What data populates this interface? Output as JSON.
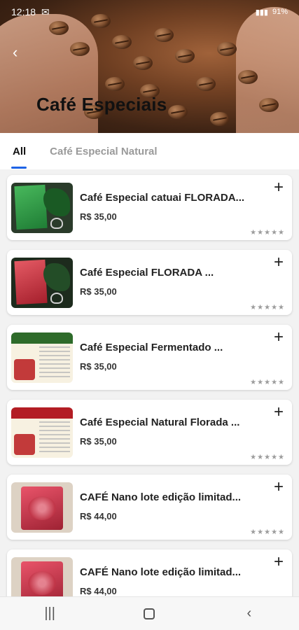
{
  "status_bar": {
    "time": "12:18",
    "battery": "91%"
  },
  "header": {
    "title": "Café Especiais"
  },
  "tabs": [
    {
      "label": "All"
    },
    {
      "label": "Café Especial Natural"
    }
  ],
  "products": [
    {
      "name": "Café Especial catuai FLORADA...",
      "price": "R$ 35,00",
      "stars": "★★★★★"
    },
    {
      "name": "Café Especial  FLORADA ...",
      "price": "R$ 35,00",
      "stars": "★★★★★"
    },
    {
      "name": "Café Especial Fermentado ...",
      "price": "R$ 35,00",
      "stars": "★★★★★"
    },
    {
      "name": "Café Especial Natural  Florada ...",
      "price": "R$ 35,00",
      "stars": "★★★★★"
    },
    {
      "name": "CAFÉ Nano lote edição limitad...",
      "price": "R$ 44,00",
      "stars": "★★★★★"
    },
    {
      "name": "CAFÉ Nano lote edição limitad...",
      "price": "R$ 44,00",
      "stars": "★★★★★"
    }
  ],
  "colors": {
    "accent": "#1e63e6"
  },
  "icons": {
    "back": "back-arrow-icon",
    "add": "plus-icon"
  }
}
